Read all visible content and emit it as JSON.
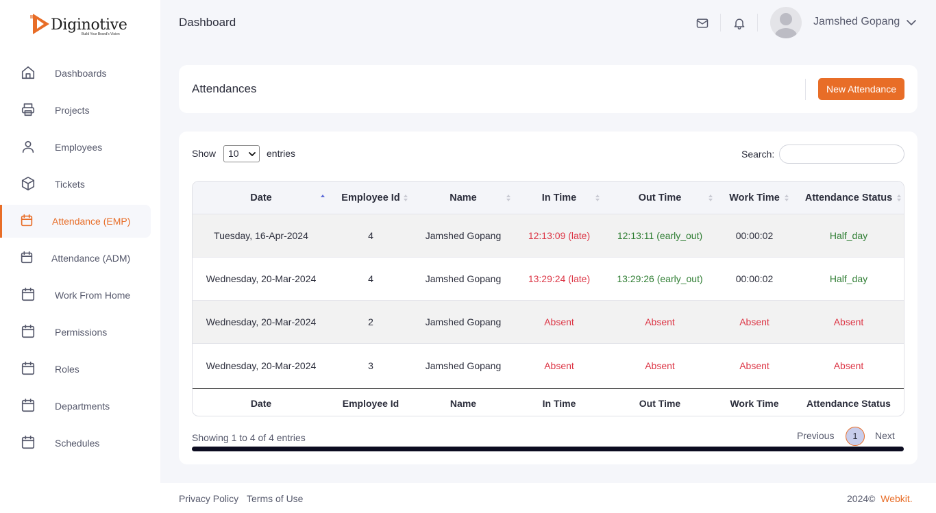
{
  "brand": {
    "name": "Diginotive",
    "tagline": "Build Your Brand's Vision",
    "accent": "#e86d27"
  },
  "sidebar": {
    "items": [
      {
        "label": "Dashboards",
        "icon": "home-icon"
      },
      {
        "label": "Projects",
        "icon": "printer-icon"
      },
      {
        "label": "Employees",
        "icon": "user-icon"
      },
      {
        "label": "Tickets",
        "icon": "cube-icon"
      },
      {
        "label": "Attendance (EMP)",
        "icon": "calendar-icon",
        "active": true
      },
      {
        "label": "Attendance (ADM)",
        "icon": "calendar-icon"
      },
      {
        "label": "Work From Home",
        "icon": "calendar-icon"
      },
      {
        "label": "Permissions",
        "icon": "calendar-icon"
      },
      {
        "label": "Roles",
        "icon": "calendar-icon"
      },
      {
        "label": "Departments",
        "icon": "calendar-icon"
      },
      {
        "label": "Schedules",
        "icon": "calendar-icon"
      }
    ]
  },
  "header": {
    "title": "Dashboard",
    "user_name": "Jamshed Gopang"
  },
  "attendances": {
    "title": "Attendances",
    "new_button": "New Attendance"
  },
  "table_controls": {
    "show_label": "Show",
    "page_length": "10",
    "entries_label": "entries",
    "search_label": "Search:",
    "search_value": ""
  },
  "table": {
    "columns": [
      "Date",
      "Employee Id",
      "Name",
      "In Time",
      "Out Time",
      "Work Time",
      "Attendance Status"
    ],
    "rows": [
      {
        "date": "Tuesday, 16-Apr-2024",
        "employee_id": "4",
        "name": "Jamshed Gopang",
        "in_time": "12:13:09 (late)",
        "out_time": "12:13:11 (early_out)",
        "work_time": "00:00:02",
        "status": "Half_day"
      },
      {
        "date": "Wednesday, 20-Mar-2024",
        "employee_id": "4",
        "name": "Jamshed Gopang",
        "in_time": "13:29:24 (late)",
        "out_time": "13:29:26 (early_out)",
        "work_time": "00:00:02",
        "status": "Half_day"
      },
      {
        "date": "Wednesday, 20-Mar-2024",
        "employee_id": "2",
        "name": "Jamshed Gopang",
        "in_time": "Absent",
        "out_time": "Absent",
        "work_time": "Absent",
        "status": "Absent"
      },
      {
        "date": "Wednesday, 20-Mar-2024",
        "employee_id": "3",
        "name": "Jamshed Gopang",
        "in_time": "Absent",
        "out_time": "Absent",
        "work_time": "Absent",
        "status": "Absent"
      }
    ]
  },
  "pagination": {
    "info": "Showing 1 to 4 of 4 entries",
    "previous": "Previous",
    "current_page": "1",
    "next": "Next"
  },
  "footer": {
    "privacy": "Privacy Policy",
    "terms": "Terms of Use",
    "copyright": "2024©",
    "brand_link": "Webkit",
    "period": "."
  }
}
